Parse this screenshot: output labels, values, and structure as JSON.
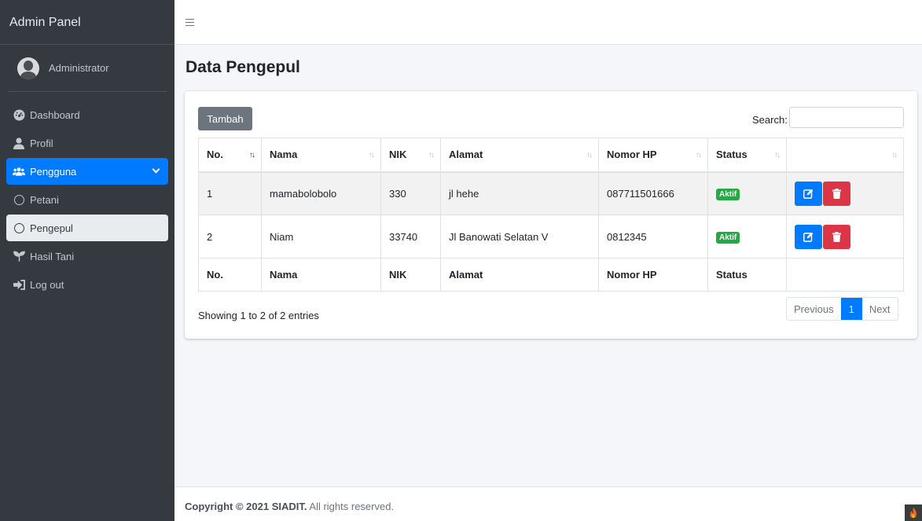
{
  "sidebar": {
    "brand": "Admin Panel",
    "user": "Administrator",
    "items": [
      {
        "label": "Dashboard",
        "icon": "dashboard-icon"
      },
      {
        "label": "Profil",
        "icon": "user-icon"
      },
      {
        "label": "Pengguna",
        "icon": "users-icon"
      },
      {
        "label": "Petani",
        "icon": "circle-icon"
      },
      {
        "label": "Pengepul",
        "icon": "circle-icon"
      },
      {
        "label": "Hasil Tani",
        "icon": "seedling-icon"
      },
      {
        "label": "Log out",
        "icon": "sign-out-icon"
      }
    ]
  },
  "page": {
    "title": "Data Pengepul"
  },
  "toolbar": {
    "add_label": "Tambah",
    "search_label": "Search:",
    "search_value": ""
  },
  "table": {
    "headers": [
      "No.",
      "Nama",
      "NIK",
      "Alamat",
      "Nomor HP",
      "Status",
      ""
    ],
    "rows": [
      {
        "no": "1",
        "nama": "mamabolobolo",
        "nik": "330",
        "alamat": "jl hehe",
        "hp": "087711501666",
        "status": "Aktif"
      },
      {
        "no": "2",
        "nama": "Niam",
        "nik": "33740",
        "alamat": "Jl Banowati Selatan V",
        "hp": "0812345",
        "status": "Aktif"
      }
    ],
    "footers": [
      "No.",
      "Nama",
      "NIK",
      "Alamat",
      "Nomor HP",
      "Status",
      ""
    ]
  },
  "pagination": {
    "info": "Showing 1 to 2 of 2 entries",
    "previous": "Previous",
    "current": "1",
    "next": "Next"
  },
  "footer": {
    "copyright": "Copyright © 2021 SIADIT.",
    "rights": "All rights reserved."
  },
  "colors": {
    "primary": "#007bff",
    "success": "#28a745",
    "danger": "#dc3545",
    "sidebar": "#343a40",
    "secondary": "#6c757d"
  }
}
